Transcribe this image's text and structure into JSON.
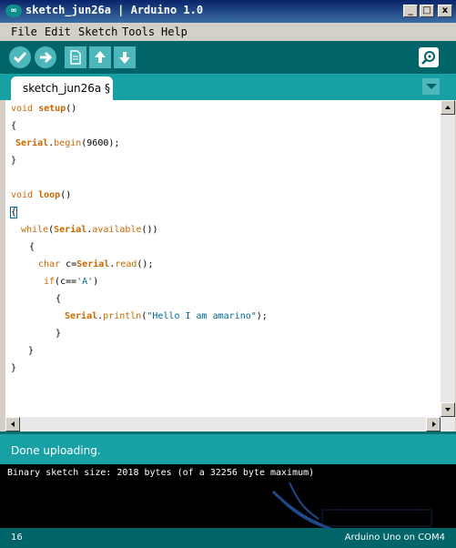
{
  "window": {
    "title": "sketch_jun26a | Arduino 1.0",
    "icon_text": "∞"
  },
  "window_controls": [
    "_",
    "□",
    "x"
  ],
  "menu": [
    "File",
    "Edit",
    "Sketch",
    "Tools",
    "Help"
  ],
  "toolbar": {
    "icons": [
      "verify-icon",
      "upload-icon",
      "new-icon",
      "open-icon",
      "save-icon",
      "serial-monitor-icon"
    ]
  },
  "tab": {
    "label": "sketch_jun26a §"
  },
  "code": {
    "l1_kw": "void",
    "l1_fn": "setup",
    "l1_rest": "()",
    "l2": "{",
    "l3_obj": "Serial",
    "l3_dot": ".",
    "l3_fn": "begin",
    "l3_rest": "(9600);",
    "l4": "}",
    "l6_kw": "void",
    "l6_fn": "loop",
    "l6_rest": "()",
    "l7": "{",
    "l8_kw": "while",
    "l8_p": "(",
    "l8_obj": "Serial",
    "l8_dot": ".",
    "l8_fn": "available",
    "l8_rest": "())",
    "l9": "{",
    "l10_kw": "char",
    "l10_mid": " c=",
    "l10_obj": "Serial",
    "l10_dot": ".",
    "l10_fn": "read",
    "l10_rest": "();",
    "l11_kw": "if",
    "l11_mid": "(c==",
    "l11_str": "'A'",
    "l11_rest": ")",
    "l12": "{",
    "l13_obj": "Serial",
    "l13_dot": ".",
    "l13_fn": "println",
    "l13_p": "(",
    "l13_str": "\"Hello I am amarino\"",
    "l13_rest": ");",
    "l14": "}",
    "l15": "}",
    "l16": "}"
  },
  "status": {
    "message": "Done uploading."
  },
  "console": {
    "line1": "Binary sketch size: 2018 bytes (of a 32256 byte maximum)"
  },
  "footer": {
    "line_number": "16",
    "board": "Arduino Uno on COM4"
  },
  "colors": {
    "toolbar": "#006468",
    "tabbar": "#17a1a5",
    "keyword": "#cc6600",
    "string": "#006699"
  }
}
